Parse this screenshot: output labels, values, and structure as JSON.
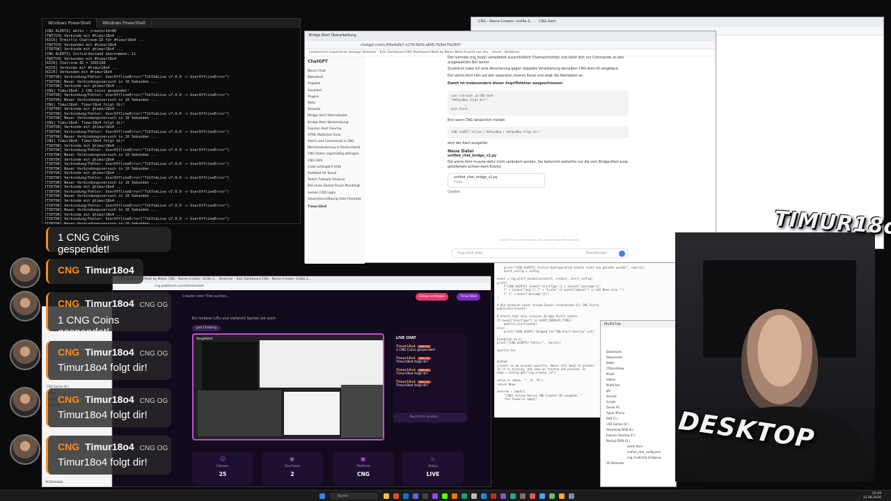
{
  "terminal": {
    "tabs": [
      "Windows PowerShell",
      "Windows PowerShell"
    ],
    "lines": [
      "[CNG ALERTS] aktiv - creatorId=80",
      "[TWITCH] Verbinde mit #timur18o4 ...",
      "[KICK] Ermittle Chatroom-ID für #timur18o4 ...",
      "[TWITCH] Verbunden mit #timur18o4",
      "[TIKTOK] Verbinde mit @timur18o4 ...",
      "[CNG ALERTS] Initialbestand übernommen: 11",
      "[TWITCH] Verbunden mit #timur18o4",
      "[KICK] Chatroom-ID = 1581198",
      "[KICK] Verbinde mit #timur18o4 ...",
      "[KICK] Verbunden mit #timur18o4",
      "[TIKTOK] Verbindung/Fehler: UserOfflineError(\"TikTokLive v7.0.0 -> UserOfflineError\")",
      "[TIKTOK] Neuer Verbindungsversuch in 10 Sekunden ...",
      "[TIKTOK] Verbinde mit @timur18o4 ...",
      "[CNG] Timur18o4: 1 CNG Coins gespendet!",
      "[TIKTOK] Verbindung/Fehler: UserOfflineError(\"TikTokLive v7.0.0 -> UserOfflineError\")",
      "[TIKTOK] Neuer Verbindungsversuch in 10 Sekunden ...",
      "[CNG] Timur18o4: Timur18o4 folgt dir!",
      "[TIKTOK] Verbinde mit @timur18o4 ...",
      "[TIKTOK] Verbindung/Fehler: UserOfflineError(\"TikTokLive v7.0.0 -> UserOfflineError\")",
      "[TIKTOK] Neuer Verbindungsversuch in 10 Sekunden ...",
      "[CNG] Timur18o4: Timur18o4 folgt dir!",
      "[TIKTOK] Verbinde mit @timur18o4 ...",
      "[TIKTOK] Verbindung/Fehler: UserOfflineError(\"TikTokLive v7.0.0 -> UserOfflineError\")",
      "[TIKTOK] Neuer Verbindungsversuch in 10 Sekunden ...",
      "[CNG] Timur18o4: Timur18o4 folgt dir!",
      "[TIKTOK] Verbinde mit @timur18o4 ...",
      "[TIKTOK] Verbindung/Fehler: UserOfflineError(\"TikTokLive v7.0.0 -> UserOfflineError\")",
      "[TIKTOK] Neuer Verbindungsversuch in 10 Sekunden ...",
      "[TIKTOK] Verbinde mit @timur18o4 ...",
      "[TIKTOK] Verbindung/Fehler: UserOfflineError(\"TikTokLive v7.0.0 -> UserOfflineError\")",
      "[TIKTOK] Neuer Verbindungsversuch in 10 Sekunden ...",
      "[TIKTOK] Verbinde mit @timur18o4 ...",
      "[TIKTOK] Verbindung/Fehler: UserOfflineError(\"TikTokLive v7.0.0 -> UserOfflineError\")",
      "[TIKTOK] Neuer Verbindungsversuch in 10 Sekunden ...",
      "[TIKTOK] Verbinde mit @timur18o4 ...",
      "[TIKTOK] Verbindung/Fehler: UserOfflineError(\"TikTokLive v7.0.0 -> UserOfflineError\")",
      "[TIKTOK] Neuer Verbindungsversuch in 10 Sekunden ...",
      "[TIKTOK] Verbinde mit @timur18o4 ...",
      "[TIKTOK] Verbindung/Fehler: UserOfflineError(\"TikTokLive v7.0.0 -> UserOfflineError\")",
      "[TIKTOK] Neuer Verbindungsversuch in 10 Sekunden ...",
      "[TIKTOK] Verbinde mit @timur18o4 ...",
      "[TIKTOK] Verbindung/Fehler: UserOfflineError(\"TikTokLive v7.0.0 -> UserOfflineError\")",
      "[TIKTOK] Neuer Verbindungsversuch in 10 Sekunden ...",
      "[TIKTOK] Verbinde mit @timur18o4 ...",
      "[TIKTOK] Verbindung/Fehler: UserOfflineError(\"TikTokLive v7.0.0 -> The requested TikTok LIVE user '@timur18o4' is offlin"
    ]
  },
  "chatgpt": {
    "tab_title": "Bridge Alert Überarbeitung",
    "url": "chatgpt.com/c/69a4a8b7-e178-8b6b-a8d5-7b9ec7fa1897",
    "bookmarks": "Lesezeichen importieren   Anzeige   Streamer - Kick Dashboard   CNG Dashboard   Multi by Melon   Mold-Ansicht von You...   Home - Bestbrain",
    "brand": "ChatGPT",
    "sidebar": [
      "Neuer Chat",
      "Bibliothek",
      "Projekte",
      "Gesplant",
      "Plugins",
      "Mehr",
      "Aktuelle",
      "Bridge Alert Überarbeitet",
      "Bridge Alert Weiterleitung",
      "Express Alert Overlay",
      "HTML Multichat Dock",
      "Alerts und Commands in CNG",
      "Namensänderung in Deutschland",
      "CNG Daten regelmäßig abfragen",
      "CNG Hilfe",
      "Code anfänglich Hilfe",
      "Profilbild für Kanal",
      "Twitch Follower Analyse",
      "Bot eines Dockel Raum Musiklegt",
      "Lemon COD Login",
      "Gewichtsschätzung Auto Produkte"
    ],
    "user": "Timur18o4",
    "paragraph1": "Der normale cng_loop() verarbeitet ausschließlich Chatnachrichten und leitet dort nur Commands an den ausgewählten Bot weiter.",
    "paragraph2": "Zusätzlich habe ich eine Absicherung gegen doppelte Verarbeitung derselben CNG-Alert-ID eingebaut.",
    "paragraph3": "Der alerts.html hört auf den separaten /events Kanal und zeigt die Alertdaten an.",
    "heading1": "Damit ist insbesondere dieser Angriffsfehler ausgeschlossen:",
    "code1": "user schreibt im CNG-Chat:\n\"#mfaysNow folgt dir!\"\n        ↓\nkein Alert",
    "line_after": "Erst wenn CNG tatsächlich meldet:",
    "code2": "[CNG ALERT] follow | #mfaysNow | #mfaysNow folgt dir!",
    "line_after2": "wird der Alert ausgelöst.",
    "heading2": "Neue Datei",
    "file_link": "unified_chat_bridge_v2.py",
    "paragraph4": "Die alerts.html musste dafür nicht verändert werden. Sie bekommt weiterhin nur die vom Bridge-Alert-Loop geliefertem echten Alert-Events.",
    "file_card": "unified_chat_bridge_v2.py",
    "file_card_sub": "Code",
    "sources": "Quellen",
    "footer": "ChatGPT kann Fehler machen. Überprüfe wichtige Informationen.",
    "input_placeholder": "Frag mich alles",
    "input_mode": "Nachdenken"
  },
  "right_browser": {
    "tab1": "CNG - Name-Creator: Größe 2...",
    "tab2": "CNG Alert"
  },
  "editor": {
    "code": "    print(\"[CNG ALERTS] Initial-Konfiguration konnte nicht neu geladen werden\", repr(e))\n    alert_config = config\n\nevent = cng_alert_normalize(alert, creator, alert_config)\nprint(\n    f\"[CNG ALERTS] {event['alertType']} | {event['username']}\"\n    f\" | {event['msg']} (\" + \"Liste\" if event[\"amount\"] is not None else \"\")\n    f\" {\" + event['message']})\"\n)\n\n# Die normalen event stream Events verarbeiten als CNG alerts\npublicAlert(event)\n\n# alerts.html only receives Bridge Alerts events.\nif event[\"alertType\"] in ALERT_OVERLAY_TYPES:\n    publish_alert(event)\nelse:\n    print(\"[CNG ALERT] Skipped for CNG-Alert-Overlay\",evt)\n\nException as e:\nprint(\"[CNG ALERTS] Fehler:\", repr(e))\n\nepsilon.txt\n\n\nAuthed:\ncreator is an account-specific. Never fall back to another\nId it is missing, and show an startup and preview. In\nname = config.get(\"cng_creator_id\")\n\nvalue in (None, \"\", 0, \"0\"):\nreturn None\n\nentered = input()\n    \"[CNG] Active Device CNG Creator-ID eingeben: \"\n    \"not found or empty\"\n"
  },
  "explorer": {
    "title": "MultiChat",
    "items": [
      "Downloads",
      "Dokumente",
      "Bilder",
      "CfStoreShow",
      "Musik",
      "Videos",
      "MultiChat",
      "gfx",
      "Sounds",
      "Scripts",
      "Dieser PC",
      "Apple iPhone",
      "SSD (C:)",
      "CSD Games (E:)",
      "Streaming DISK (E:)",
      "Express Desktop (F:)",
      "Backup DISK (G:)"
    ],
    "files": [
      "alerts.html",
      "unified_chat_config.json",
      "cng_multichat_bridge.py"
    ],
    "count": "26 Elemente"
  },
  "dashboard": {
    "tabs": "CNG Dashboard   Multi by Melon   CNG - Name-Creator: Größe 2...   Streamer - Kick Dashboard   CNG - Name-Creator: Größe 2...",
    "url": "cng.platthorm.com/streamdash",
    "search": "Creator oder Titel suchen...",
    "btn_follow": "Follow entfolgen",
    "btn_user": "Timur18o4",
    "hero_text": "Ein lockerer L/flu und vielleicht Sachen wir auch",
    "chip": "Just Chatting",
    "preview_label": "Vorgeführt",
    "live_chat_title": "LIVE CHAT",
    "chat": [
      {
        "name": "Timur18o4",
        "badge": "CNG OG",
        "text": "1 CNG Coins gespendet!"
      },
      {
        "name": "Timur18o4",
        "badge": "CNG OG",
        "text": "Timur18o4 folgt dir!"
      },
      {
        "name": "Timur18o4",
        "badge": "CNG OG",
        "text": "Timur18o4 folgt dir!"
      },
      {
        "name": "Timur18o4",
        "badge": "CNG OG",
        "text": "Timur18o4 folgt dir!"
      }
    ],
    "chat_input": "Nachricht senden...",
    "stats": [
      {
        "label": "Follower",
        "value": "25",
        "icon": "users-icon"
      },
      {
        "label": "Zuschauer",
        "value": "2",
        "icon": "eye-icon"
      },
      {
        "label": "Plattform",
        "value": "CNG",
        "icon": "platform-icon"
      },
      {
        "label": "Status",
        "value": "LIVE",
        "icon": "flame-icon"
      }
    ]
  },
  "left_panel": {
    "items": [
      "CSD Games (E:)",
      "Trendy",
      "Stream",
      "Tiertonen"
    ],
    "count": "26 Elemente"
  },
  "alerts": {
    "a1_msg": "1 CNG Coins gespendet!",
    "a2_cng": "CNG",
    "a2_name": "Timur18o4",
    "a3_cng": "CNG",
    "a3_name": "Timur18o4",
    "a3_og": "CNG OG",
    "a3_msg": "1 CNG Coins gespendet!",
    "a4_cng": "CNG",
    "a4_name": "Timur18o4",
    "a4_og": "CNG OG",
    "a4_msg": "Timur18o4 folgt dir!",
    "a5_cng": "CNG",
    "a5_name": "Timur18o4",
    "a5_og": "CNG OG",
    "a5_msg": "Timur18o4 folgt dir!",
    "a6_cng": "CNG",
    "a6_name": "Timur18o4",
    "a6_og": "CNG OG",
    "a6_msg": "Timur18o4 folgt dir!"
  },
  "overlay": {
    "logo_top": "TIMUR18o4",
    "logo_bottom": "DESKTOP"
  },
  "taskbar": {
    "search": "Suche",
    "time": "20:49",
    "date": "31.08.2026"
  },
  "colors": {
    "accent_orange": "#ff8a1f",
    "dashboard_purple": "#c14fd6",
    "live_red": "#e53935"
  }
}
